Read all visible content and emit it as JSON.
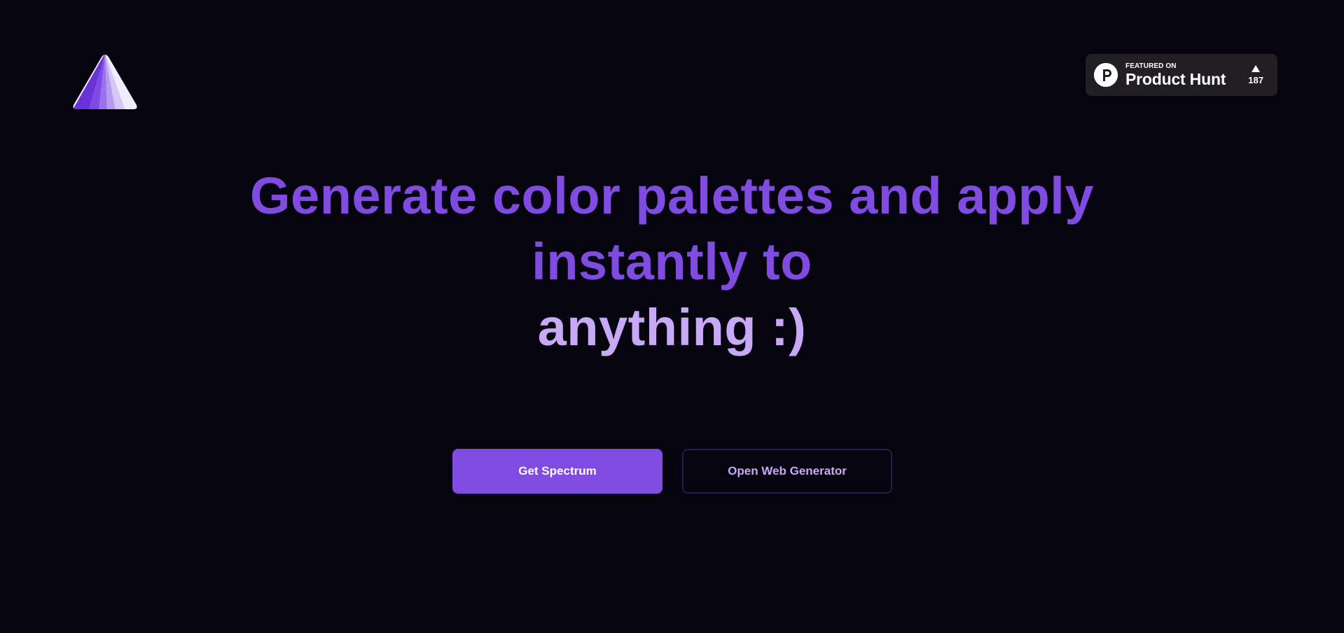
{
  "colors": {
    "background": "#06040e",
    "accent": "#7f4be0",
    "accent_light": "#c8a9f5",
    "badge_bg": "#211f24"
  },
  "header": {
    "logo_icon": "prism-triangle-icon"
  },
  "product_hunt": {
    "featured_label": "FEATURED ON",
    "name": "Product Hunt",
    "votes": "187",
    "logo_icon": "product-hunt-p-icon",
    "upvote_icon": "triangle-up-icon"
  },
  "hero": {
    "line1": "Generate color palettes and apply",
    "line2": "instantly to",
    "line3": "anything :)"
  },
  "actions": {
    "primary_label": "Get Spectrum",
    "secondary_label": "Open Web Generator"
  }
}
